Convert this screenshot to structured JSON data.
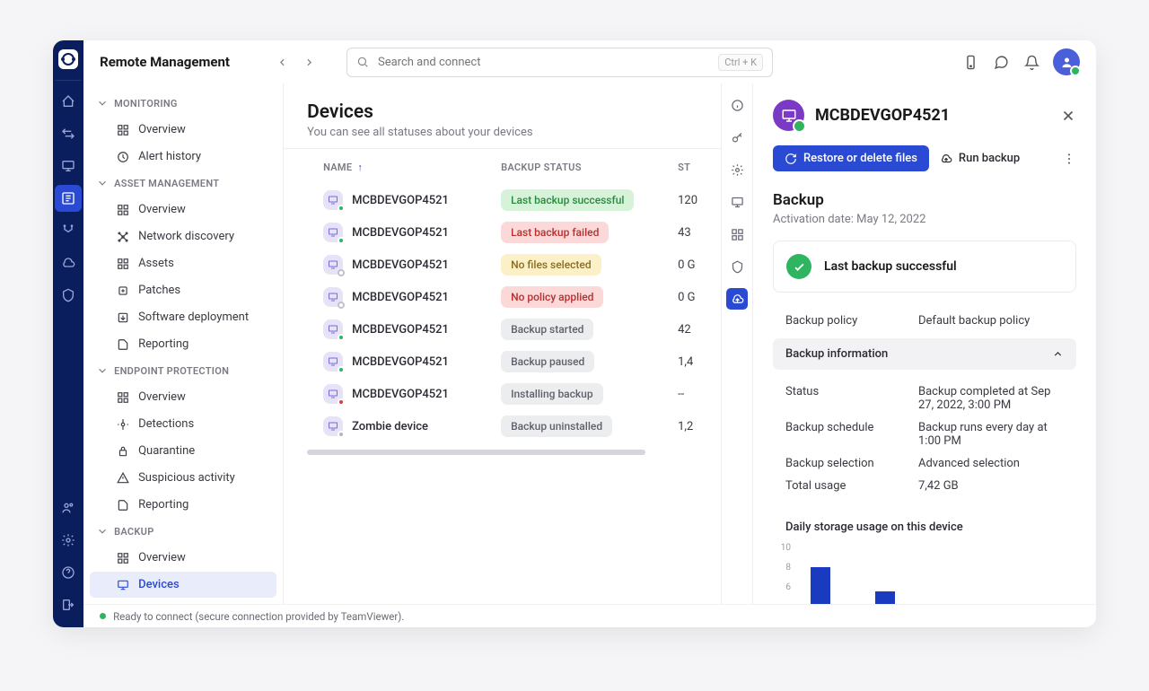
{
  "topbar": {
    "title": "Remote Management",
    "search_placeholder": "Search and connect",
    "shortcut": "Ctrl + K"
  },
  "sidebar": {
    "groups": [
      {
        "name": "MONITORING",
        "items": [
          "Overview",
          "Alert history"
        ]
      },
      {
        "name": "ASSET MANAGEMENT",
        "items": [
          "Overview",
          "Network discovery",
          "Assets",
          "Patches",
          "Software deployment",
          "Reporting"
        ]
      },
      {
        "name": "ENDPOINT PROTECTION",
        "items": [
          "Overview",
          "Detections",
          "Quarantine",
          "Suspicious activity",
          "Reporting"
        ]
      },
      {
        "name": "BACKUP",
        "items": [
          "Overview",
          "Devices"
        ]
      }
    ],
    "active_item": "Devices"
  },
  "content": {
    "title": "Devices",
    "subtitle": "You can see all statuses about your devices",
    "columns": {
      "name": "NAME",
      "status": "BACKUP STATUS",
      "storage": "STORAGE"
    },
    "rows": [
      {
        "name": "MCBDEVGOP4521",
        "dot": "green",
        "badge": "Last backup successful",
        "badge_class": "success",
        "storage": "120"
      },
      {
        "name": "MCBDEVGOP4521",
        "dot": "green",
        "badge": "Last backup failed",
        "badge_class": "fail",
        "storage": "43"
      },
      {
        "name": "MCBDEVGOP4521",
        "dot": "outline",
        "badge": "No files selected",
        "badge_class": "warn",
        "storage": "0 G"
      },
      {
        "name": "MCBDEVGOP4521",
        "dot": "outline",
        "badge": "No policy applied",
        "badge_class": "fail",
        "storage": "0 G"
      },
      {
        "name": "MCBDEVGOP4521",
        "dot": "green",
        "badge": "Backup started",
        "badge_class": "neutral",
        "storage": "42"
      },
      {
        "name": "MCBDEVGOP4521",
        "dot": "green",
        "badge": "Backup paused",
        "badge_class": "neutral",
        "storage": "1,4"
      },
      {
        "name": "MCBDEVGOP4521",
        "dot": "red",
        "badge": "Installing backup",
        "badge_class": "neutral",
        "storage": "--"
      },
      {
        "name": "Zombie device",
        "dot": "grey",
        "badge": "Backup uninstalled",
        "badge_class": "neutral",
        "storage": "1,2"
      }
    ]
  },
  "statusbar": {
    "text": "Ready to connect (secure connection provided by TeamViewer)."
  },
  "detail": {
    "title": "MCBDEVGOP4521",
    "actions": {
      "restore": "Restore or delete files",
      "run": "Run backup"
    },
    "section_title": "Backup",
    "activation": "Activation date: May 12, 2022",
    "status_text": "Last backup successful",
    "policy_label": "Backup policy",
    "policy_value": "Default backup policy",
    "accordion": "Backup information",
    "info": [
      {
        "k": "Status",
        "v": "Backup completed at Sep 27, 2022, 3:00 PM"
      },
      {
        "k": "Backup schedule",
        "v": "Backup runs every day at 1:00 PM"
      },
      {
        "k": "Backup selection",
        "v": "Advanced selection"
      },
      {
        "k": "Total usage",
        "v": "7,42 GB"
      }
    ],
    "chart_title": "Daily storage usage on this device"
  },
  "chart_data": {
    "type": "bar",
    "y_ticks": [
      10,
      8,
      6
    ],
    "bars": [
      9,
      5
    ]
  }
}
